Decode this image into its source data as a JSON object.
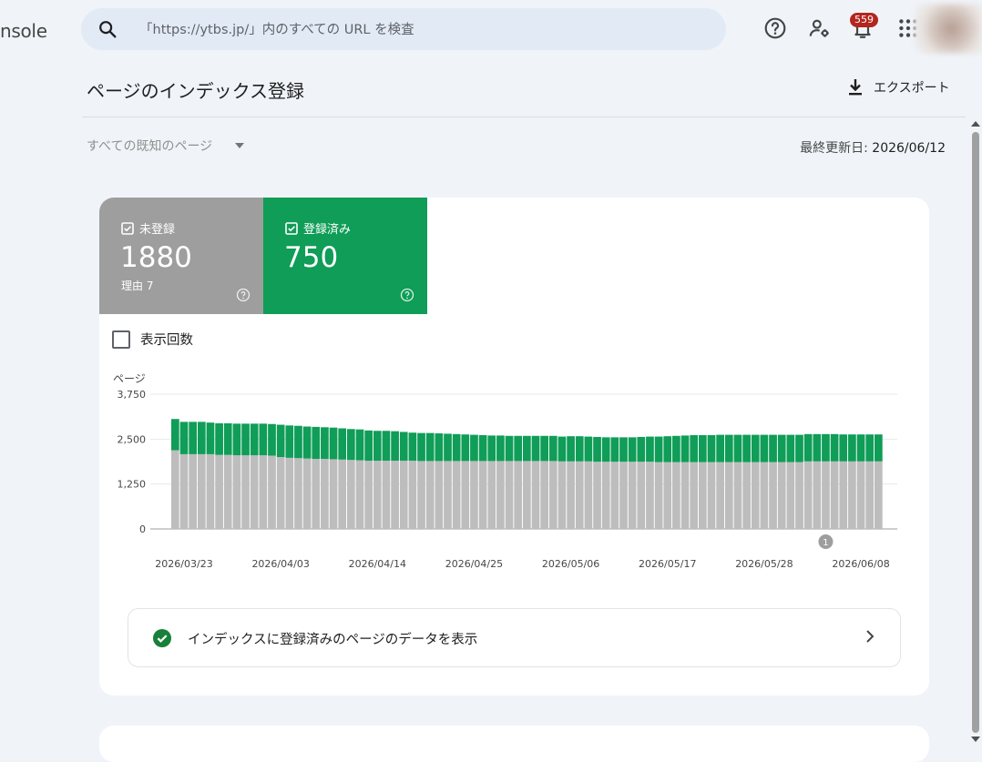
{
  "app": {
    "logo_text": "nsole"
  },
  "search": {
    "placeholder": "「https://ytbs.jp/」内のすべての URL を検査"
  },
  "header": {
    "notification_count": "559"
  },
  "page": {
    "title": "ページのインデックス登録",
    "export_label": "エクスポート",
    "filter_label": "すべての既知のページ",
    "updated_label": "最終更新日:",
    "updated_date": "2026/06/12"
  },
  "tiles": {
    "not_indexed": {
      "label": "未登録",
      "value": "1880",
      "sub": "理由 7",
      "color": "#9e9e9e"
    },
    "indexed": {
      "label": "登録済み",
      "value": "750",
      "color": "#0f9d58"
    }
  },
  "impressions_label": "表示回数",
  "view_link_label": "インデックスに登録済みのページのデータを表示",
  "chart_data": {
    "type": "bar",
    "stacked": true,
    "ylabel": "ページ",
    "ylim": [
      0,
      3750
    ],
    "yticks": [
      "3,750",
      "2,500",
      "1,250",
      "0"
    ],
    "ytick_values": [
      3750,
      2500,
      1250,
      0
    ],
    "x_tick_labels": [
      "2026/03/23",
      "2026/04/03",
      "2026/04/14",
      "2026/04/25",
      "2026/05/06",
      "2026/05/17",
      "2026/05/28",
      "2026/06/08"
    ],
    "x_tick_indices": [
      1,
      12,
      23,
      34,
      45,
      56,
      67,
      78
    ],
    "annotation": {
      "label": "1",
      "index": 74
    },
    "series": [
      {
        "name": "未登録",
        "color": "#bdbdbd",
        "values": [
          2190,
          2080,
          2080,
          2080,
          2080,
          2060,
          2060,
          2050,
          2050,
          2050,
          2050,
          2040,
          2000,
          1980,
          1970,
          1960,
          1950,
          1950,
          1940,
          1930,
          1920,
          1910,
          1900,
          1900,
          1900,
          1900,
          1900,
          1900,
          1890,
          1890,
          1890,
          1890,
          1890,
          1890,
          1890,
          1890,
          1890,
          1890,
          1890,
          1890,
          1890,
          1890,
          1890,
          1890,
          1880,
          1880,
          1880,
          1880,
          1870,
          1870,
          1870,
          1870,
          1870,
          1870,
          1870,
          1860,
          1860,
          1860,
          1860,
          1860,
          1860,
          1860,
          1860,
          1860,
          1860,
          1860,
          1860,
          1860,
          1860,
          1860,
          1860,
          1860,
          1880,
          1880,
          1880,
          1880,
          1880,
          1880,
          1880,
          1880,
          1880
        ]
      },
      {
        "name": "登録済み",
        "color": "#0f9d58",
        "values": [
          870,
          900,
          900,
          900,
          880,
          880,
          880,
          880,
          880,
          880,
          880,
          880,
          900,
          900,
          900,
          890,
          890,
          880,
          880,
          870,
          860,
          860,
          840,
          830,
          830,
          820,
          800,
          780,
          780,
          780,
          770,
          760,
          750,
          740,
          730,
          720,
          710,
          710,
          700,
          700,
          700,
          700,
          700,
          700,
          690,
          700,
          700,
          690,
          690,
          680,
          680,
          680,
          680,
          690,
          700,
          710,
          720,
          730,
          740,
          750,
          750,
          750,
          760,
          760,
          760,
          760,
          760,
          760,
          760,
          760,
          760,
          760,
          760,
          760,
          760,
          760,
          750,
          750,
          750,
          750,
          750
        ]
      }
    ]
  }
}
